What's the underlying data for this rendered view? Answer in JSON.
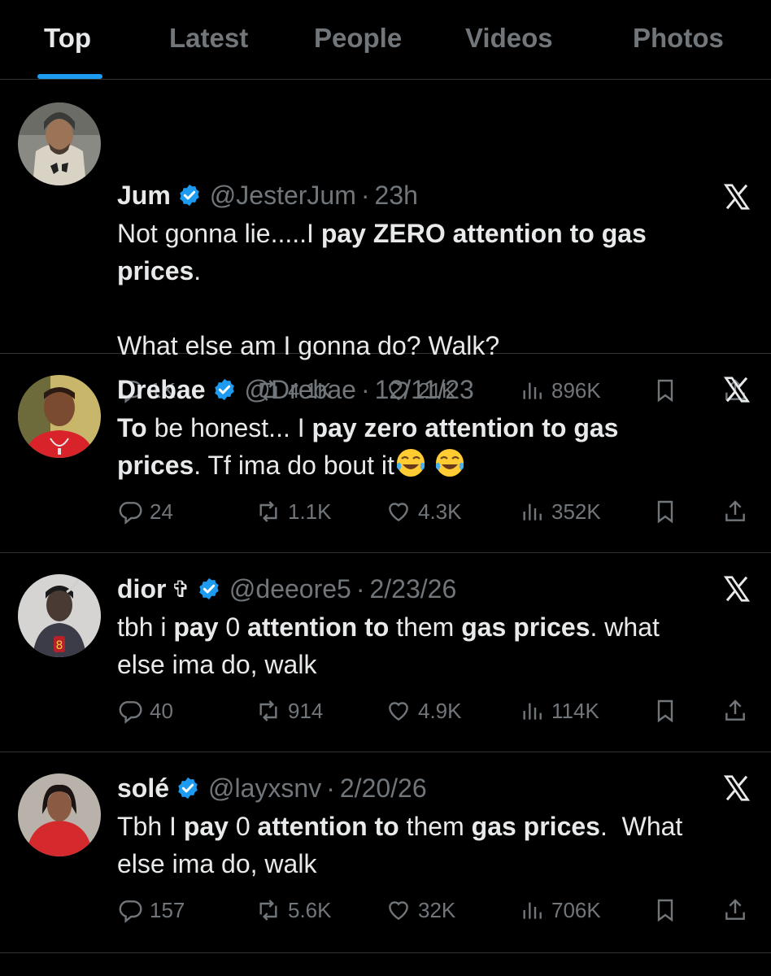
{
  "tabs": [
    "Top",
    "Latest",
    "People",
    "Videos",
    "Photos"
  ],
  "tweets": [
    {
      "name": "Jum",
      "handle": "@JesterJum",
      "time": "23h",
      "line1_pre": "Not gonna lie.....I ",
      "line1_bold": "pay ZERO attention to gas",
      "line2_bold": "prices",
      "line2_post": ".",
      "line3": "What else am I gonna do? Walk?",
      "replies": "1K",
      "reposts": "4.1K",
      "likes": "21K",
      "views": "896K"
    },
    {
      "name": "Drebae",
      "handle": "@Drebae",
      "time": "12/11/23",
      "line1_bold_a": "To",
      "line1_mid": " be honest... I ",
      "line1_bold_b": "pay zero attention to gas",
      "line2_bold": "prices",
      "line2_post": ". Tf ima do bout it",
      "replies": "24",
      "reposts": "1.1K",
      "likes": "4.3K",
      "views": "352K"
    },
    {
      "name": "dior",
      "name_symbol": "✞",
      "handle": "@deeore5",
      "time": "2/23/26",
      "t1": "tbh i ",
      "b1": "pay",
      "t2": " 0 ",
      "b2": "attention to",
      "t3": " them ",
      "b3": "gas prices",
      "t4": ". what",
      "line2": "else ima do, walk",
      "replies": "40",
      "reposts": "914",
      "likes": "4.9K",
      "views": "114K"
    },
    {
      "name": "solé",
      "handle": "@layxsnv",
      "time": "2/20/26",
      "t1": "Tbh I ",
      "b1": "pay",
      "t2": " 0 ",
      "b2": "attention to",
      "t3": " them ",
      "b3": "gas prices",
      "t4": ".  What",
      "line2": "else ima do, walk",
      "replies": "157",
      "reposts": "5.6K",
      "likes": "32K",
      "views": "706K"
    }
  ],
  "icons": {
    "reply": "reply-icon",
    "repost": "repost-icon",
    "like": "heart-icon",
    "views": "views-icon",
    "bookmark": "bookmark-icon",
    "share": "share-icon",
    "verified": "verified-badge-icon",
    "x": "x-logo-icon",
    "emoji": "tears-of-joy-emoji"
  },
  "colors": {
    "accent": "#1d9bf0",
    "background": "#000000",
    "secondary_text": "#71767b",
    "primary_text": "#e7e9ea"
  }
}
